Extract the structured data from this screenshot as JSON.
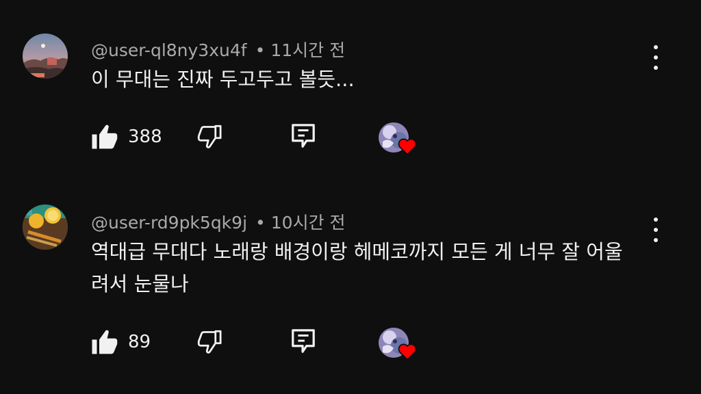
{
  "comments": [
    {
      "author": "@user-ql8ny3xu4f",
      "separator": "•",
      "time": "11시간 전",
      "text": "이 무대는 진짜 두고두고 볼듯...",
      "likes": "388",
      "avatar_icon": "avatar-sunset-landscape",
      "heart_icon": "creator-heart-icon"
    },
    {
      "author": "@user-rd9pk5qk9j",
      "separator": "•",
      "time": "10시간 전",
      "text": "역대급 무대다 노래랑 배경이랑 헤메코까지 모든 게 너무 잘 어울려서 눈물나",
      "likes": "89",
      "avatar_icon": "avatar-lemon-food",
      "heart_icon": "creator-heart-icon"
    }
  ],
  "colors": {
    "background": "#0f0f0f",
    "text_primary": "#f1f1f1",
    "text_secondary": "#aaaaaa",
    "heart": "#ff0000"
  }
}
